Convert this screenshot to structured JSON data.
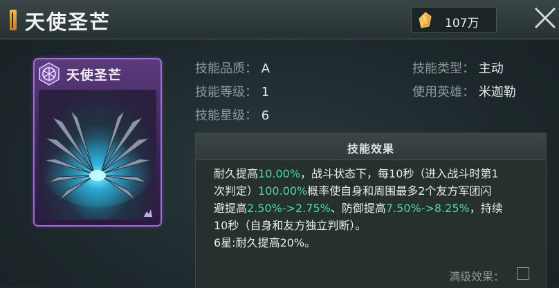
{
  "header": {
    "title": "天使圣芒",
    "currency_icon": "gold-crystal-icon",
    "currency_value": "107万",
    "close_icon": "close-icon"
  },
  "card": {
    "title": "天使圣芒",
    "emblem_icon": "hexagon-skill-icon",
    "art": "mechanical-wings-icon",
    "rank_icon": "rank-badge-icon"
  },
  "stats": {
    "quality_label": "技能品质：",
    "quality_value": "A",
    "level_label": "技能等级：",
    "level_value": "1",
    "star_label": "技能星级：",
    "star_value": "6",
    "type_label": "技能类型：",
    "type_value": "主动",
    "hero_label": "使用英雄：",
    "hero_value": "米迦勒"
  },
  "effect": {
    "title": "技能效果",
    "l1a": "耐久提高",
    "l1b": "10.00%",
    "l1c": "，战斗状态下，每10秒（进入战斗时第1",
    "l2a": "次判定）",
    "l2b": "100.00%",
    "l2c": "概率使自身和周围最多2个友方军团闪",
    "l3a": "避提高",
    "l3b": "2.50%->2.75%",
    "l3c": "、防御提高",
    "l3d": "7.50%->8.25%",
    "l3e": "，持续",
    "l4": "10秒（自身和友方独立判断）。",
    "l5": "6星:耐久提高20%。",
    "max_level_label": "满级效果："
  },
  "colors": {
    "highlight": "#4fd8a4",
    "card_border": "#9a6fcf",
    "title_accent": "#f2c14c"
  }
}
